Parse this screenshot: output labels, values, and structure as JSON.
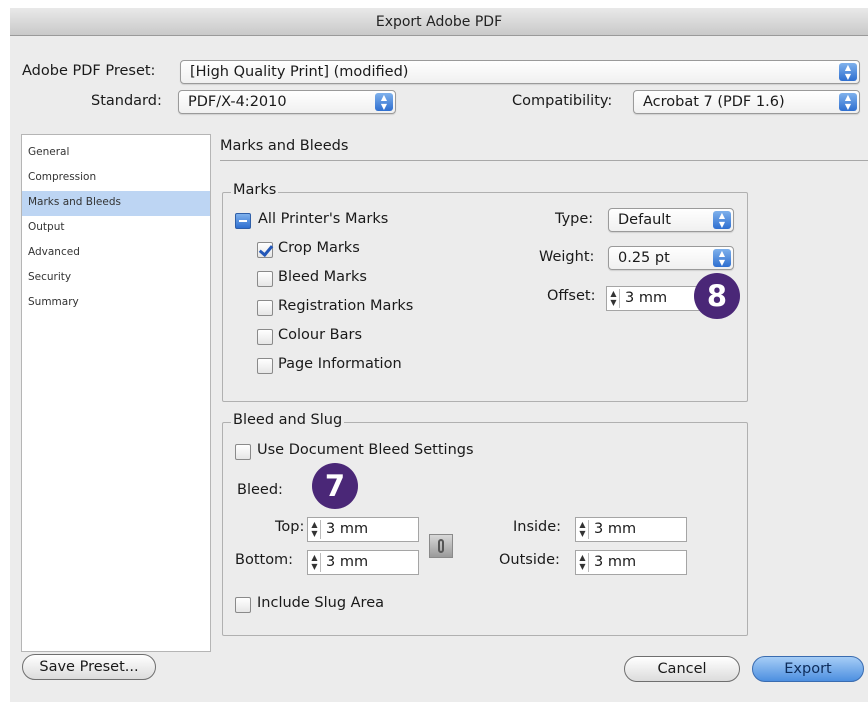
{
  "window": {
    "title": "Export Adobe PDF"
  },
  "preset": {
    "label": "Adobe PDF Preset:",
    "value": "[High Quality Print] (modified)",
    "standard_label": "Standard:",
    "standard_value": "PDF/X-4:2010",
    "compat_label": "Compatibility:",
    "compat_value": "Acrobat 7 (PDF 1.6)"
  },
  "sidebar": {
    "items": [
      {
        "label": "General"
      },
      {
        "label": "Compression"
      },
      {
        "label": "Marks and Bleeds",
        "selected": true
      },
      {
        "label": "Output"
      },
      {
        "label": "Advanced"
      },
      {
        "label": "Security"
      },
      {
        "label": "Summary"
      }
    ]
  },
  "page": {
    "heading": "Marks and Bleeds"
  },
  "marks": {
    "title": "Marks",
    "all_printers": {
      "label": "All Printer's Marks",
      "state": "mixed"
    },
    "options": [
      {
        "label": "Crop Marks",
        "checked": true
      },
      {
        "label": "Bleed Marks",
        "checked": false
      },
      {
        "label": "Registration Marks",
        "checked": false
      },
      {
        "label": "Colour Bars",
        "checked": false
      },
      {
        "label": "Page Information",
        "checked": false
      }
    ],
    "type_label": "Type:",
    "type_value": "Default",
    "weight_label": "Weight:",
    "weight_value": "0.25 pt",
    "offset_label": "Offset:",
    "offset_value": "3 mm"
  },
  "bleed": {
    "title": "Bleed and Slug",
    "use_doc_label": "Use Document Bleed Settings",
    "use_doc_checked": false,
    "bleed_label": "Bleed:",
    "top_label": "Top:",
    "top_value": "3 mm",
    "bottom_label": "Bottom:",
    "bottom_value": "3 mm",
    "inside_label": "Inside:",
    "inside_value": "3 mm",
    "outside_label": "Outside:",
    "outside_value": "3 mm",
    "slug_label": "Include Slug Area",
    "slug_checked": false
  },
  "callouts": {
    "marks": "8",
    "bleed": "7"
  },
  "buttons": {
    "save_preset": "Save Preset...",
    "cancel": "Cancel",
    "export": "Export"
  },
  "colors": {
    "callout": "#4a2777",
    "selection": "#bdd5f3",
    "accent": "#4d8fe0"
  }
}
